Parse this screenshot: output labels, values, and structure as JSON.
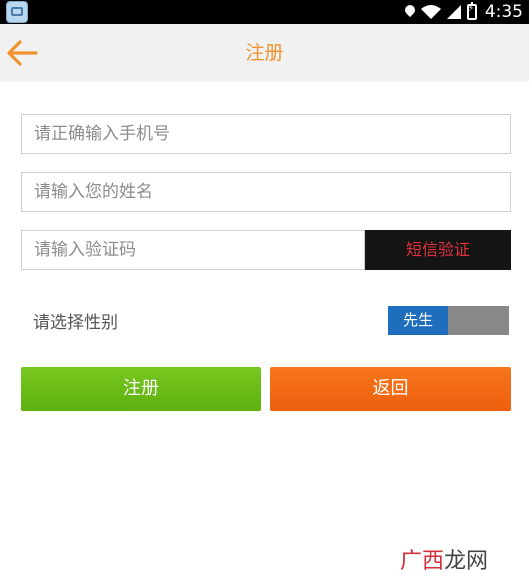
{
  "status_bar": {
    "time": "4:35"
  },
  "header": {
    "title": "注册"
  },
  "form": {
    "phone_placeholder": "请正确输入手机号",
    "name_placeholder": "请输入您的姓名",
    "code_placeholder": "请输入验证码",
    "sms_button": "短信验证",
    "gender_label": "请选择性别",
    "gender_value": "先生"
  },
  "actions": {
    "register": "注册",
    "back": "返回"
  },
  "watermark": {
    "part1": "广西",
    "part2": "龙网"
  },
  "colors": {
    "accent": "#f0922d",
    "register_green": "#6abd17",
    "back_orange": "#f36a14",
    "toggle_blue": "#1f6dbd",
    "sms_text_red": "#e0313c"
  }
}
